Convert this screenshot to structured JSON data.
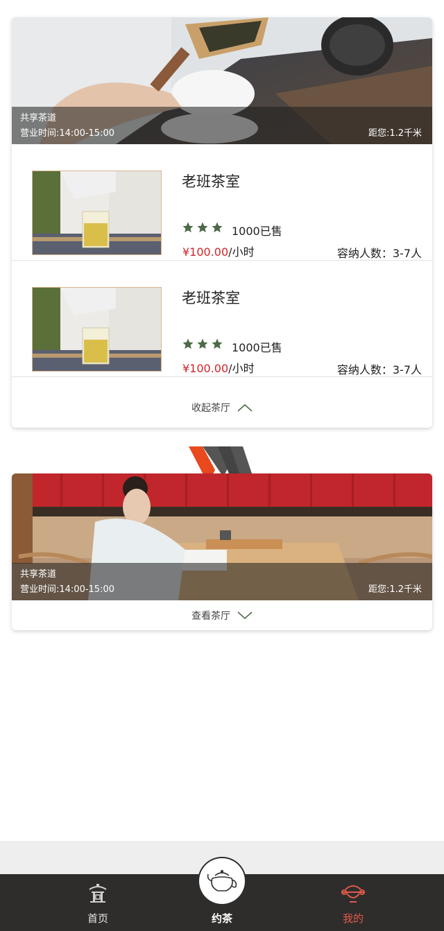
{
  "card1": {
    "hero": {
      "name": "共享茶道",
      "hours": "营业时间:14:00-15:00",
      "distance": "距您:1.2千米"
    },
    "rooms": [
      {
        "title": "老班茶室",
        "sold": "1000已售",
        "price": "¥100.00",
        "unit": "/小时",
        "capacity": "容纳人数：3-7人",
        "stars": 3
      },
      {
        "title": "老班茶室",
        "sold": "1000已售",
        "price": "¥100.00",
        "unit": "/小时",
        "capacity": "容纳人数：3-7人",
        "stars": 3
      }
    ],
    "toggle_label": "收起茶厅"
  },
  "card2": {
    "hero": {
      "name": "共享茶道",
      "hours": "营业时间:14:00-15:00",
      "distance": "距您:1.2千米"
    },
    "toggle_label": "查看茶厅"
  },
  "tabbar": {
    "home": "首页",
    "tea": "约茶",
    "mine": "我的"
  },
  "icons": {
    "star": "star-icon",
    "collapse": "chevron-up-icon",
    "expand": "chevron-down-icon",
    "home": "pavilion-icon",
    "tea": "teapot-icon",
    "mine": "profile-icon"
  },
  "colors": {
    "price": "#d2232a",
    "star": "#4d6a48",
    "tabbar": "#2e2d2b",
    "mine_active": "#e05a4c"
  }
}
